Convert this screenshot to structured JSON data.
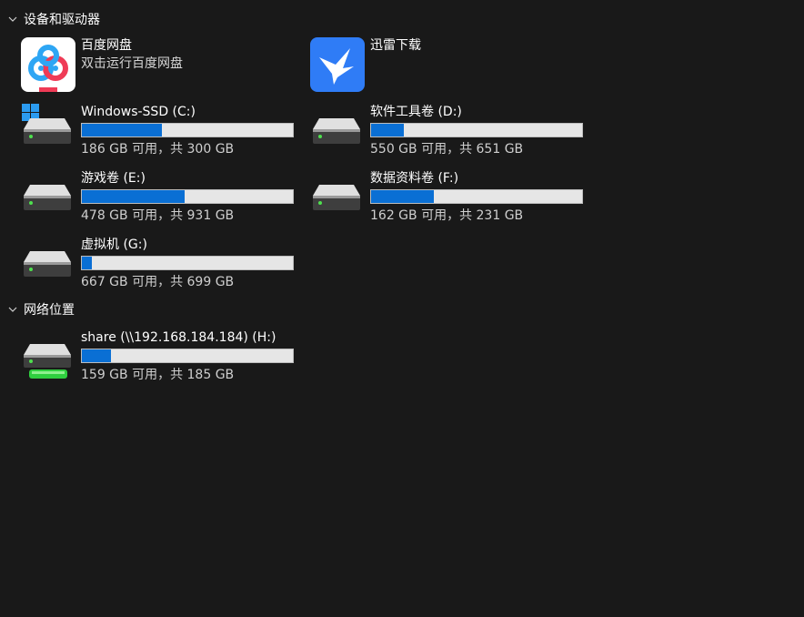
{
  "sections": {
    "devices": {
      "title": "设备和驱动器"
    },
    "network": {
      "title": "网络位置"
    }
  },
  "apps": [
    {
      "name": "百度网盘",
      "description": "双击运行百度网盘",
      "icon": "baidu-netdisk-icon"
    },
    {
      "name": "迅雷下载",
      "description": "",
      "icon": "xunlei-icon"
    }
  ],
  "drives": [
    {
      "name": "Windows-SSD (C:)",
      "space": "186 GB 可用，共 300 GB",
      "used_fraction": 0.38,
      "icon": "windows-drive-icon"
    },
    {
      "name": "软件工具卷 (D:)",
      "space": "550 GB 可用，共 651 GB",
      "used_fraction": 0.155,
      "icon": "drive-icon"
    },
    {
      "name": "游戏卷 (E:)",
      "space": "478 GB 可用，共 931 GB",
      "used_fraction": 0.487,
      "icon": "drive-icon"
    },
    {
      "name": "数据资料卷 (F:)",
      "space": "162 GB 可用，共 231 GB",
      "used_fraction": 0.299,
      "icon": "drive-icon"
    },
    {
      "name": "虚拟机 (G:)",
      "space": "667 GB 可用，共 699 GB",
      "used_fraction": 0.046,
      "icon": "drive-icon"
    }
  ],
  "network_drives": [
    {
      "name": "share (\\\\192.168.184.184) (H:)",
      "space": "159 GB 可用，共 185 GB",
      "used_fraction": 0.14,
      "icon": "network-drive-icon"
    }
  ],
  "colors": {
    "background": "#191919",
    "bar_fill": "#0a6fd4",
    "bar_track": "#e6e6e6",
    "baidu_bg": "#ffffff",
    "xunlei_bg": "#2f7cf6"
  }
}
